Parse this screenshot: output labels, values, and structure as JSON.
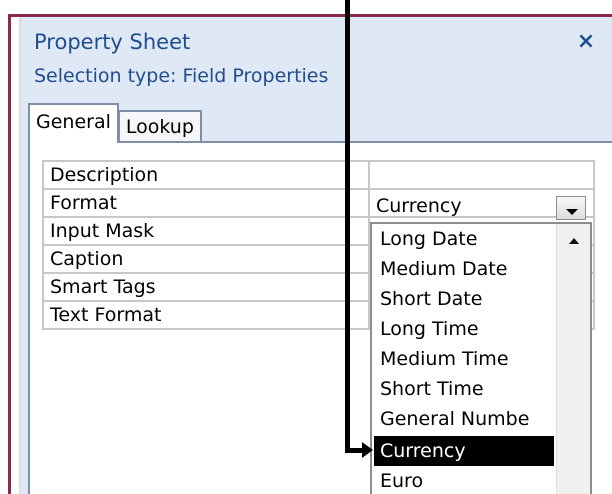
{
  "window": {
    "title": "Property Sheet",
    "close_glyph": "×"
  },
  "selection_type": "Selection type:  Field Properties",
  "tabs": [
    {
      "label": "General",
      "active": true
    },
    {
      "label": "Lookup",
      "active": false
    }
  ],
  "properties": [
    {
      "name": "Description",
      "value": ""
    },
    {
      "name": "Format",
      "value": "Currency"
    },
    {
      "name": "Input Mask",
      "value": ""
    },
    {
      "name": "Caption",
      "value": ""
    },
    {
      "name": "Smart Tags",
      "value": ""
    },
    {
      "name": "Text Format",
      "value": ""
    }
  ],
  "format_dropdown": {
    "current_value": "Currency",
    "options": [
      "Long Date",
      "Medium Date",
      "Short Date",
      "Long Time",
      "Medium Time",
      "Short Time",
      "General Numbe",
      "Currency",
      "Euro"
    ],
    "selected_option": "Currency"
  },
  "icons": {
    "dropdown": "chevron-down-icon",
    "scroll_up": "scroll-up-icon",
    "close": "close-icon"
  },
  "colors": {
    "title_text": "#1f4e8f",
    "panel_bg": "#dfe8f5",
    "frame_border": "#8b2a4a",
    "selected_bg": "#000000",
    "selected_text": "#ffffff"
  }
}
